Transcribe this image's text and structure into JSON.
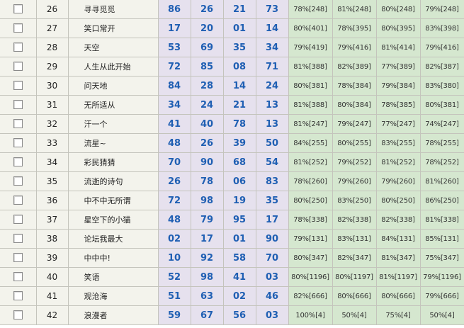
{
  "rows": [
    {
      "idx": "26",
      "name": "寻寻觅觅",
      "nums": [
        "86",
        "26",
        "21",
        "73"
      ],
      "stats": [
        "78%[248]",
        "81%[248]",
        "80%[248]",
        "79%[248]"
      ]
    },
    {
      "idx": "27",
      "name": "笑口常开",
      "nums": [
        "17",
        "20",
        "01",
        "14"
      ],
      "stats": [
        "80%[401]",
        "78%[395]",
        "80%[395]",
        "83%[398]"
      ]
    },
    {
      "idx": "28",
      "name": "天空",
      "nums": [
        "53",
        "69",
        "35",
        "34"
      ],
      "stats": [
        "79%[419]",
        "79%[416]",
        "81%[414]",
        "79%[416]"
      ]
    },
    {
      "idx": "29",
      "name": "人生从此开始",
      "nums": [
        "72",
        "85",
        "08",
        "71"
      ],
      "stats": [
        "81%[388]",
        "82%[389]",
        "77%[389]",
        "82%[387]"
      ]
    },
    {
      "idx": "30",
      "name": "问天地",
      "nums": [
        "84",
        "28",
        "14",
        "24"
      ],
      "stats": [
        "80%[381]",
        "78%[384]",
        "79%[384]",
        "83%[380]"
      ]
    },
    {
      "idx": "31",
      "name": "无所适从",
      "nums": [
        "34",
        "24",
        "21",
        "13"
      ],
      "stats": [
        "81%[388]",
        "80%[384]",
        "78%[385]",
        "80%[381]"
      ]
    },
    {
      "idx": "32",
      "name": "汗一个",
      "nums": [
        "41",
        "40",
        "78",
        "13"
      ],
      "stats": [
        "81%[247]",
        "79%[247]",
        "77%[247]",
        "74%[247]"
      ]
    },
    {
      "idx": "33",
      "name": "流星~",
      "nums": [
        "48",
        "26",
        "39",
        "50"
      ],
      "stats": [
        "84%[255]",
        "80%[255]",
        "83%[255]",
        "78%[255]"
      ]
    },
    {
      "idx": "34",
      "name": "彩民猜猜",
      "nums": [
        "70",
        "90",
        "68",
        "54"
      ],
      "stats": [
        "81%[252]",
        "79%[252]",
        "81%[252]",
        "78%[252]"
      ]
    },
    {
      "idx": "35",
      "name": "流逝的诗句",
      "nums": [
        "26",
        "78",
        "06",
        "83"
      ],
      "stats": [
        "78%[260]",
        "79%[260]",
        "79%[260]",
        "81%[260]"
      ]
    },
    {
      "idx": "36",
      "name": "中不中无所谓",
      "nums": [
        "72",
        "98",
        "19",
        "35"
      ],
      "stats": [
        "80%[250]",
        "83%[250]",
        "80%[250]",
        "86%[250]"
      ]
    },
    {
      "idx": "37",
      "name": "星空下的小猫",
      "nums": [
        "48",
        "79",
        "95",
        "17"
      ],
      "stats": [
        "78%[338]",
        "82%[338]",
        "82%[338]",
        "81%[338]"
      ]
    },
    {
      "idx": "38",
      "name": "论坛我最大",
      "nums": [
        "02",
        "17",
        "01",
        "90"
      ],
      "stats": [
        "79%[131]",
        "83%[131]",
        "84%[131]",
        "85%[131]"
      ]
    },
    {
      "idx": "39",
      "name": "中中中!",
      "nums": [
        "10",
        "92",
        "58",
        "70"
      ],
      "stats": [
        "80%[347]",
        "82%[347]",
        "81%[347]",
        "75%[347]"
      ]
    },
    {
      "idx": "40",
      "name": "笑语",
      "nums": [
        "52",
        "98",
        "41",
        "03"
      ],
      "stats": [
        "80%[1196]",
        "80%[1197]",
        "81%[1197]",
        "79%[1196]"
      ]
    },
    {
      "idx": "41",
      "name": "观沧海",
      "nums": [
        "51",
        "63",
        "02",
        "46"
      ],
      "stats": [
        "82%[666]",
        "80%[666]",
        "80%[666]",
        "79%[666]"
      ]
    },
    {
      "idx": "42",
      "name": "浪漫者",
      "nums": [
        "59",
        "67",
        "56",
        "03"
      ],
      "stats": [
        "100%[4]",
        "50%[4]",
        "75%[4]",
        "50%[4]"
      ]
    }
  ]
}
